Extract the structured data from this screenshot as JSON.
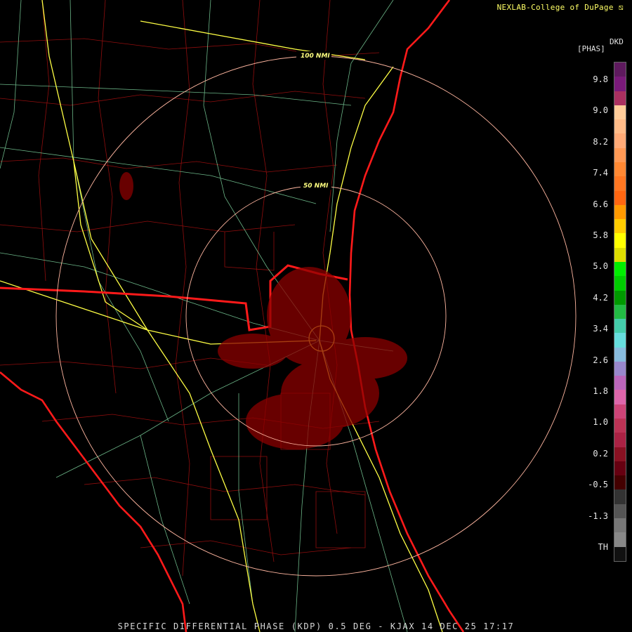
{
  "credit": "NEXLAB-College of DuPage",
  "logo_icon": "nexlab-logo-icon",
  "legend": {
    "unit_code": "DKD",
    "unit_name": "[PHAS]",
    "labels": [
      "9.8",
      "9.0",
      "8.2",
      "7.4",
      "6.6",
      "5.8",
      "5.0",
      "4.2",
      "3.4",
      "2.6",
      "1.8",
      "1.0",
      "0.2",
      "-0.5",
      "-1.3",
      "TH"
    ],
    "colors": [
      "#5e1a5e",
      "#7a1a7a",
      "#aa3060",
      "#ffcc99",
      "#ffbb88",
      "#ffaa77",
      "#ff9955",
      "#ff8833",
      "#ff7722",
      "#ff6611",
      "#ff9900",
      "#ffcc00",
      "#ffff00",
      "#dddd00",
      "#00ee00",
      "#00cc00",
      "#009900",
      "#22bb44",
      "#44ccaa",
      "#66dddd",
      "#88bbdd",
      "#9988cc",
      "#bb66bb",
      "#dd66aa",
      "#cc4477",
      "#bb3355",
      "#aa2244",
      "#881122",
      "#660011",
      "#440000",
      "#333333",
      "#555555",
      "#777777",
      "#888888",
      "#111111"
    ]
  },
  "range_rings": [
    "100 NMI",
    "50 NMI"
  ],
  "footer": "SPECIFIC DIFFERENTIAL PHASE (KDP) 0.5 DEG - KJAX 14 DEC 25 17:17",
  "colors": {
    "coast": "#ff1a1a",
    "county": "#b01010",
    "highway": "#ffff44",
    "road": "#7fd6a0",
    "ring": "#ffb6a0",
    "echo": "#8b0000"
  }
}
